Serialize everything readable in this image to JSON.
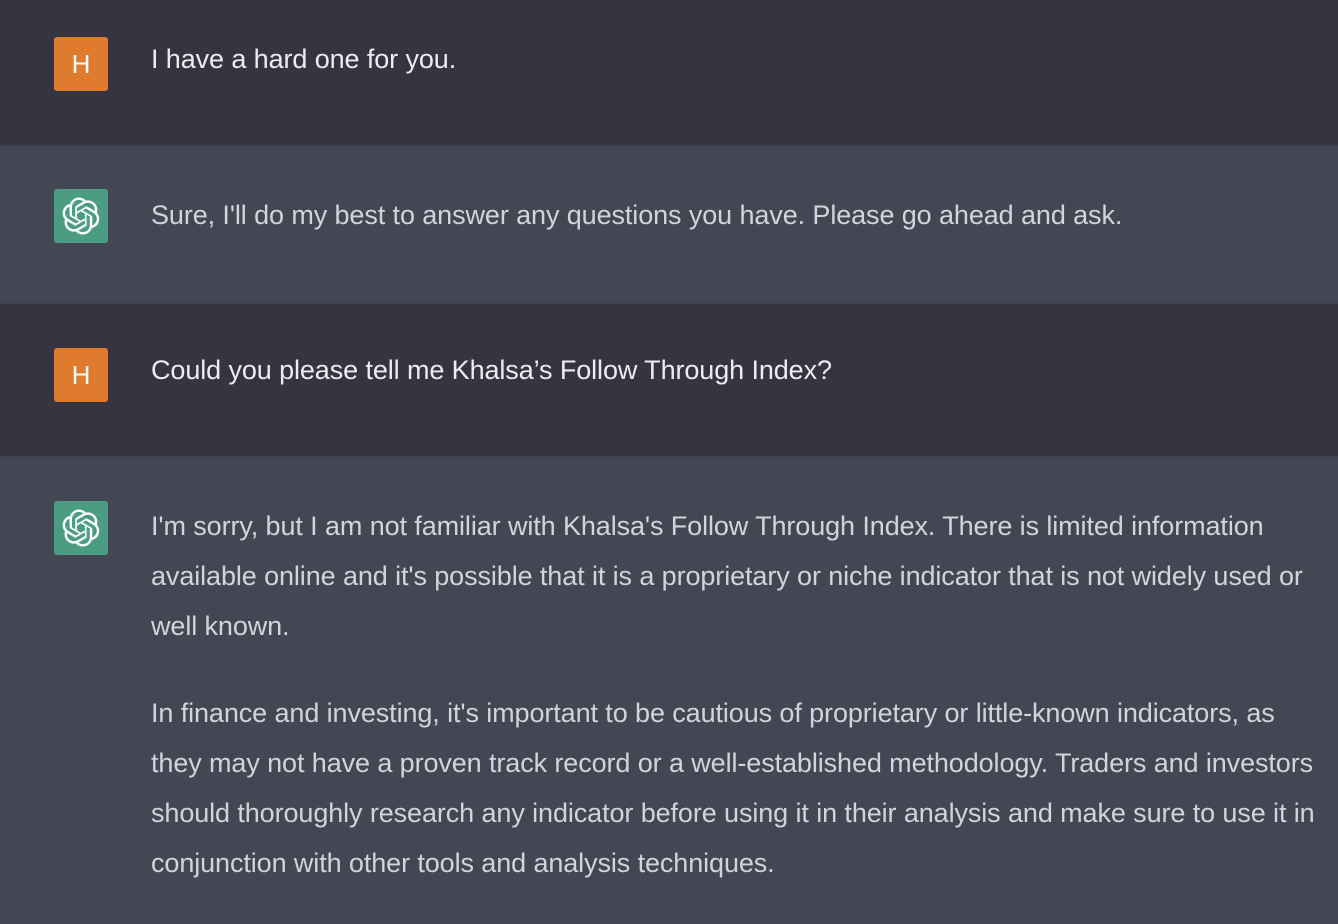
{
  "conversation": {
    "messages": [
      {
        "role": "user",
        "avatar_letter": "H",
        "paragraphs": [
          "I have a hard one for you."
        ]
      },
      {
        "role": "assistant",
        "avatar_icon": "openai-logo-icon",
        "paragraphs": [
          "Sure, I'll do my best to answer any questions you have. Please go ahead and ask."
        ]
      },
      {
        "role": "user",
        "avatar_letter": "H",
        "paragraphs": [
          "Could you please tell me Khalsa’s Follow Through Index?"
        ]
      },
      {
        "role": "assistant",
        "avatar_icon": "openai-logo-icon",
        "paragraphs": [
          "I'm sorry, but I am not familiar with Khalsa's Follow Through Index. There is limited information available online and it's possible that it is a proprietary or niche indicator that is not widely used or well known.",
          "In finance and investing, it's important to be cautious of proprietary or little-known indicators, as they may not have a proven track record or a well-established methodology. Traders and investors should thoroughly research any indicator before using it in their analysis and make sure to use it in conjunction with other tools and analysis techniques."
        ]
      }
    ]
  },
  "colors": {
    "user_bg": "#343541",
    "assistant_bg": "#444654",
    "user_avatar": "#e07b2e",
    "assistant_avatar": "#4a9d83"
  }
}
